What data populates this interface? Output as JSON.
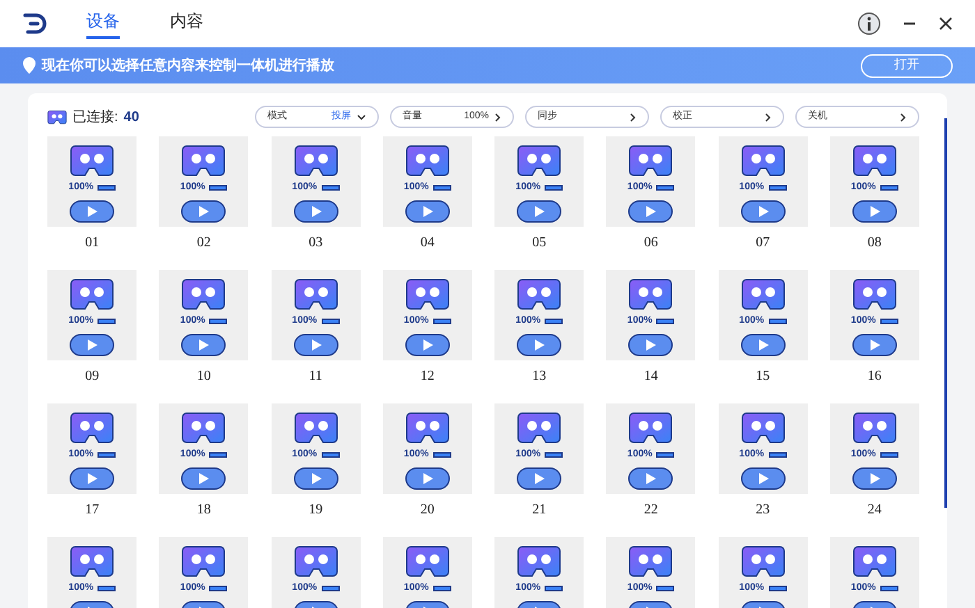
{
  "tabs": [
    {
      "label": "设备",
      "selected": true
    },
    {
      "label": "内容",
      "selected": false
    }
  ],
  "banner": {
    "text": "现在你可以选择任意内容来控制一体机进行播放",
    "button": "打开"
  },
  "connected": {
    "label": "已连接:",
    "count": "40"
  },
  "filters": [
    {
      "label": "模式",
      "value": "投屏",
      "kind": "dropdown"
    },
    {
      "label": "音量",
      "value": "100%",
      "kind": "link"
    },
    {
      "label": "同步",
      "kind": "link"
    },
    {
      "label": "校正",
      "kind": "link"
    },
    {
      "label": "关机",
      "kind": "link"
    }
  ],
  "devices": [
    {
      "battery": "100%",
      "level": 1,
      "label": "01"
    },
    {
      "battery": "100%",
      "level": 1,
      "label": "02"
    },
    {
      "battery": "100%",
      "level": 1,
      "label": "03"
    },
    {
      "battery": "100%",
      "level": 1,
      "label": "04"
    },
    {
      "battery": "100%",
      "level": 1,
      "label": "05"
    },
    {
      "battery": "100%",
      "level": 1,
      "label": "06"
    },
    {
      "battery": "100%",
      "level": 1,
      "label": "07"
    },
    {
      "battery": "100%",
      "level": 1,
      "label": "08"
    },
    {
      "battery": "100%",
      "level": 1,
      "label": "09"
    },
    {
      "battery": "100%",
      "level": 1,
      "label": "10"
    },
    {
      "battery": "100%",
      "level": 1,
      "label": "11"
    },
    {
      "battery": "100%",
      "level": 1,
      "label": "12"
    },
    {
      "battery": "100%",
      "level": 1,
      "label": "13"
    },
    {
      "battery": "100%",
      "level": 1,
      "label": "14"
    },
    {
      "battery": "100%",
      "level": 1,
      "label": "15"
    },
    {
      "battery": "100%",
      "level": 1,
      "label": "16"
    },
    {
      "battery": "100%",
      "level": 1,
      "label": "17"
    },
    {
      "battery": "100%",
      "level": 1,
      "label": "18"
    },
    {
      "battery": "100%",
      "level": 1,
      "label": "19"
    },
    {
      "battery": "100%",
      "level": 1,
      "label": "20"
    },
    {
      "battery": "100%",
      "level": 1,
      "label": "21"
    },
    {
      "battery": "100%",
      "level": 1,
      "label": "22"
    },
    {
      "battery": "100%",
      "level": 1,
      "label": "23"
    },
    {
      "battery": "100%",
      "level": 1,
      "label": "24"
    },
    {
      "battery": "100%",
      "level": 1
    },
    {
      "battery": "100%",
      "level": 1
    },
    {
      "battery": "100%",
      "level": 1
    },
    {
      "battery": "100%",
      "level": 1
    },
    {
      "battery": "100%",
      "level": 1
    },
    {
      "battery": "100%",
      "level": 1
    },
    {
      "battery": "100%",
      "level": 1
    },
    {
      "battery": "100%",
      "level": 1
    }
  ]
}
